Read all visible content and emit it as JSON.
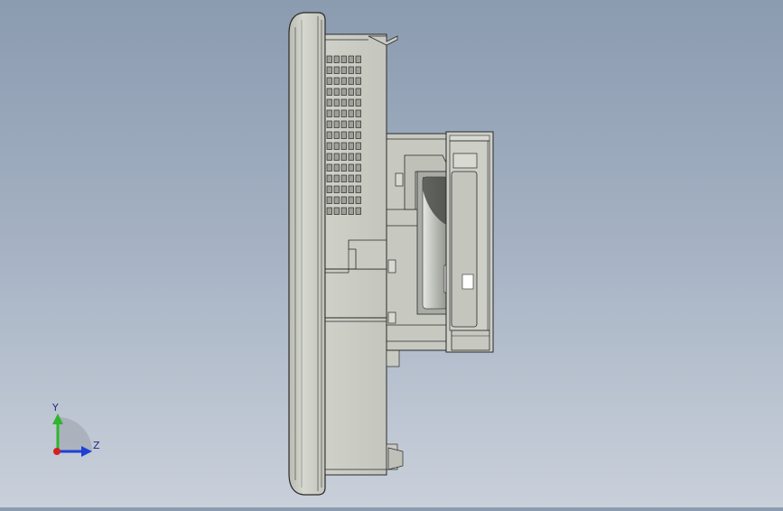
{
  "viewport": {
    "background_top": "#8b9bb0",
    "background_bottom": "#c9d0da",
    "model_color": "#c9cbc3",
    "edge_color": "#2a2a2a"
  },
  "triad": {
    "y_label": "Y",
    "z_label": "Z",
    "y_color": "#2fb52f",
    "z_color": "#1f3fd6",
    "x_color": "#d42020"
  }
}
